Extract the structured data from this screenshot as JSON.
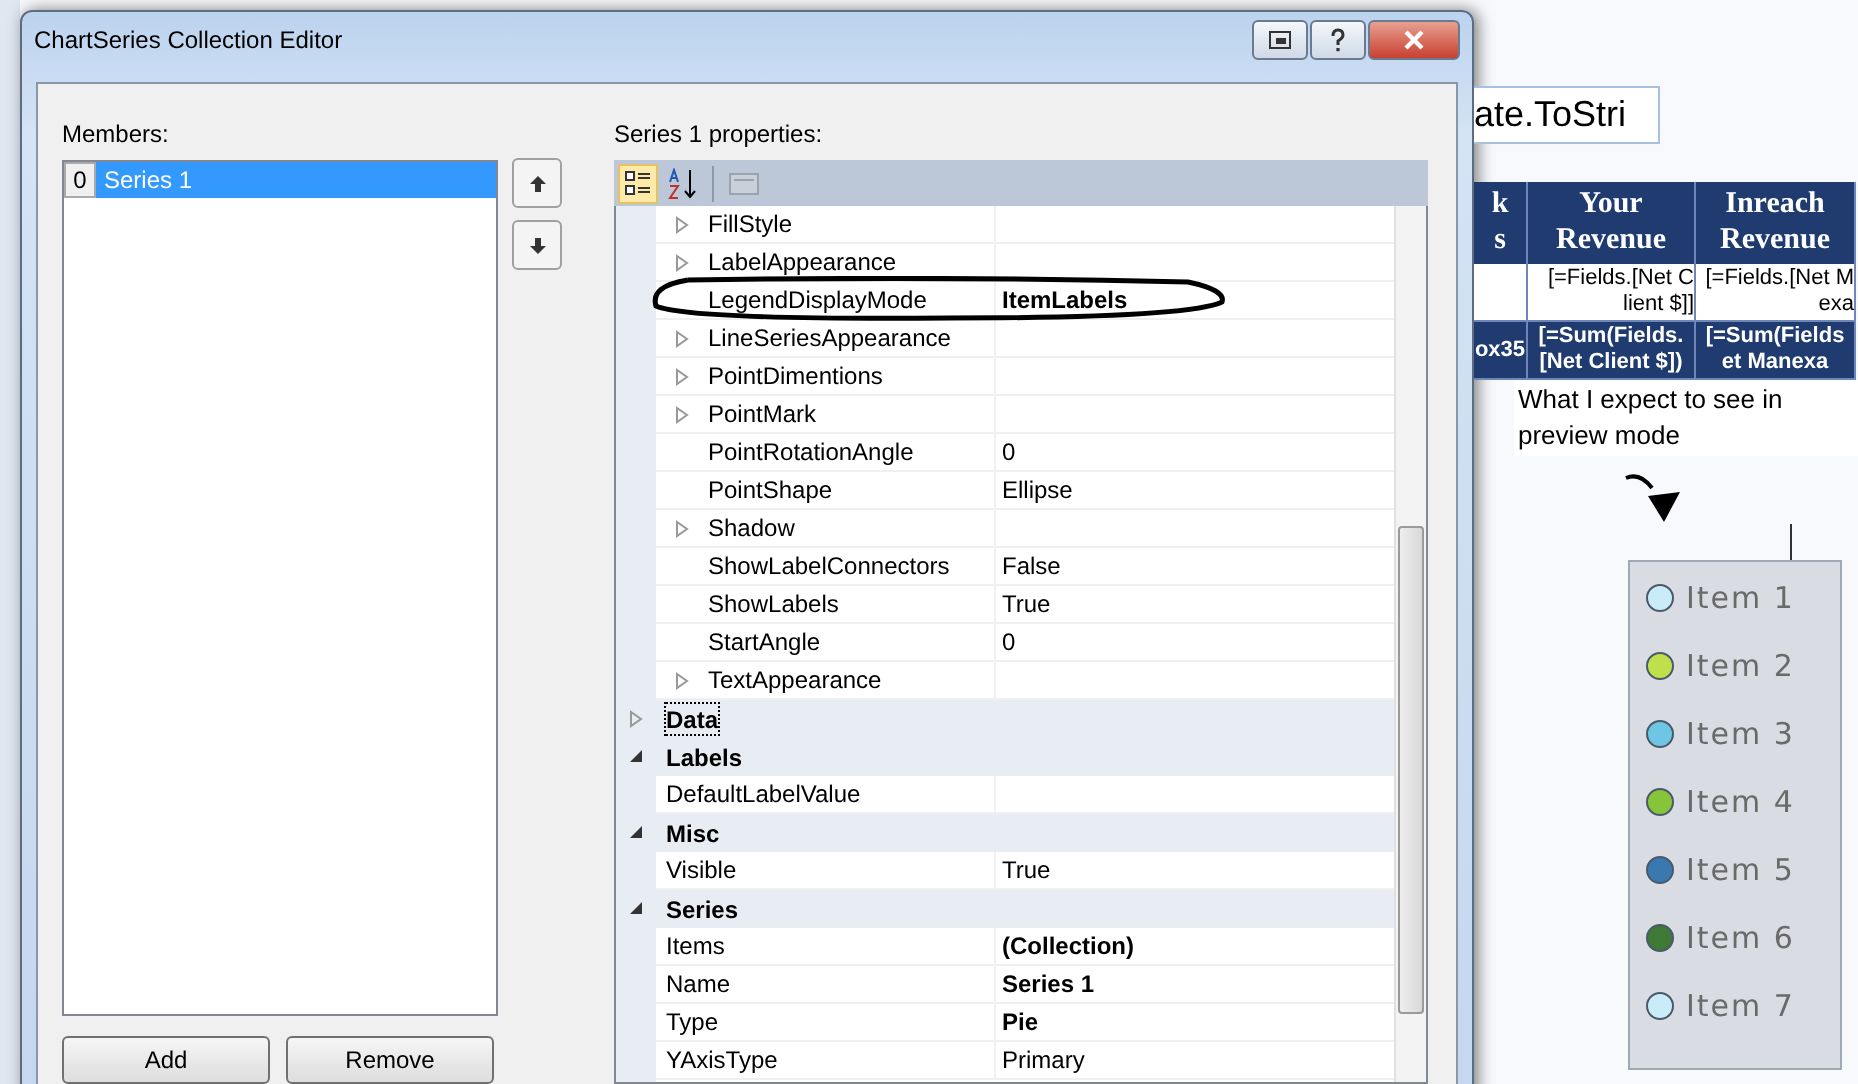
{
  "window": {
    "title": "ChartSeries Collection Editor"
  },
  "members": {
    "label": "Members:",
    "items": [
      {
        "index": "0",
        "name": "Series 1",
        "selected": true
      }
    ]
  },
  "member_buttons": [
    "Add",
    "Remove"
  ],
  "properties": {
    "label": "Series 1 properties:",
    "toolbar": [
      {
        "kind": "categorized",
        "selected": true,
        "disabled": false
      },
      {
        "kind": "alphabetical",
        "selected": false,
        "disabled": false
      },
      {
        "kind": "property-pages",
        "selected": false,
        "disabled": true
      }
    ],
    "nested_rows": [
      {
        "name": "FillStyle",
        "expandable": true
      },
      {
        "name": "LabelAppearance",
        "expandable": true
      },
      {
        "name": "LegendDisplayMode",
        "value": "ItemLabels",
        "expandable": false,
        "modified": true
      },
      {
        "name": "LineSeriesAppearance",
        "expandable": true
      },
      {
        "name": "PointDimentions",
        "expandable": true
      },
      {
        "name": "PointMark",
        "expandable": true
      },
      {
        "name": "PointRotationAngle",
        "value": "0",
        "expandable": false,
        "modified": false
      },
      {
        "name": "PointShape",
        "value": "Ellipse",
        "expandable": false,
        "modified": false
      },
      {
        "name": "Shadow",
        "expandable": true
      },
      {
        "name": "ShowLabelConnectors",
        "value": "False",
        "expandable": false,
        "modified": false
      },
      {
        "name": "ShowLabels",
        "value": "True",
        "expandable": false,
        "modified": false
      },
      {
        "name": "StartAngle",
        "value": "0",
        "expandable": false,
        "modified": false
      },
      {
        "name": "TextAppearance",
        "expandable": true
      }
    ],
    "categories": [
      {
        "name": "Data",
        "expanded": false,
        "focused": true
      },
      {
        "name": "Labels",
        "expanded": true,
        "focused": false,
        "children": [
          {
            "name": "DefaultLabelValue"
          }
        ]
      },
      {
        "name": "Misc",
        "expanded": true,
        "focused": false,
        "children": [
          {
            "name": "Visible",
            "value": "True",
            "modified": false
          }
        ]
      },
      {
        "name": "Series",
        "expanded": true,
        "focused": false,
        "children": [
          {
            "name": "Items",
            "value": "(Collection)",
            "modified": true
          },
          {
            "name": "Name",
            "value": "Series 1",
            "modified": true
          },
          {
            "name": "Type",
            "value": "Pie",
            "modified": true
          },
          {
            "name": "YAxisType",
            "value": "Primary",
            "modified": false
          }
        ]
      }
    ]
  },
  "report": {
    "expression_box": "ate.ToStri",
    "table": {
      "header": [
        [
          "k",
          "s"
        ],
        [
          "Your",
          "Revenue"
        ],
        [
          "Inreach",
          "Revenue"
        ]
      ],
      "rows": [
        {
          "kind": "detail",
          "cells": [
            [],
            [
              "[=Fields.[Net C",
              "lient $]]"
            ],
            [
              "[=Fields.[Net M",
              "exa"
            ]
          ]
        },
        {
          "kind": "total",
          "cells": [
            [
              "ox35"
            ],
            [
              "[=Sum(Fields.",
              "[Net Client $])"
            ],
            [
              "[=Sum(Fields",
              "et Manexa"
            ]
          ]
        }
      ]
    },
    "note": "What I expect to see in preview mode",
    "legend": [
      {
        "label": "Item 1",
        "color": "#c9ecf8"
      },
      {
        "label": "Item 2",
        "color": "#bfe04a"
      },
      {
        "label": "Item 3",
        "color": "#6cc6e4"
      },
      {
        "label": "Item 4",
        "color": "#86c43a"
      },
      {
        "label": "Item 5",
        "color": "#3a78b0"
      },
      {
        "label": "Item 6",
        "color": "#3e7a35"
      },
      {
        "label": "Item 7",
        "color": "#c9ecf8"
      }
    ]
  }
}
